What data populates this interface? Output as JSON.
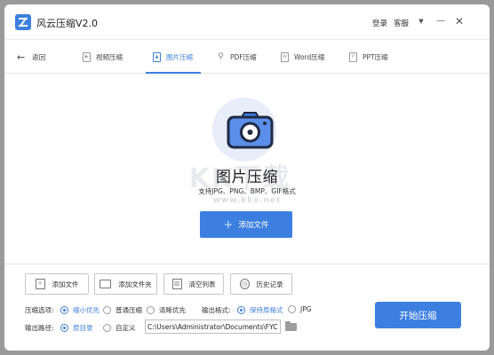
{
  "app": {
    "title": "风云压缩V2.0"
  },
  "titlebar": {
    "login": "登录",
    "service": "客服",
    "menu_icon": "dropdown-triangle",
    "minimize_icon": "minus",
    "close_icon": "x"
  },
  "nav": {
    "back_label": "返回",
    "tabs": [
      {
        "label": "视频压缩",
        "icon": "video-file-icon",
        "active": false
      },
      {
        "label": "图片压缩",
        "icon": "image-file-icon",
        "active": true
      },
      {
        "label": "PDF压缩",
        "icon": "pdf-file-icon",
        "active": false
      },
      {
        "label": "Word压缩",
        "icon": "word-file-icon",
        "active": false
      },
      {
        "label": "PPT压缩",
        "icon": "ppt-file-icon",
        "active": false
      }
    ]
  },
  "main": {
    "title": "图片压缩",
    "subtitle": "支持JPG、PNG、BMP、GIF格式",
    "add_file_label": "添加文件",
    "watermark_text": "KK下载",
    "watermark_url": "www.kkx.net"
  },
  "toolbar": {
    "add_file": "添加文件",
    "add_folder": "添加文件夹",
    "clear_list": "清空列表",
    "history": "历史记录"
  },
  "options": {
    "compress_label": "压缩选项:",
    "compress_options": [
      {
        "label": "缩小优先",
        "selected": true
      },
      {
        "label": "普通压缩",
        "selected": false
      },
      {
        "label": "清晰优先",
        "selected": false
      }
    ],
    "format_label": "输出格式:",
    "format_options": [
      {
        "label": "保持原格式",
        "selected": true
      },
      {
        "label": "JPG",
        "selected": false
      }
    ],
    "output_label": "输出路径:",
    "output_options": [
      {
        "label": "原目录",
        "selected": true
      },
      {
        "label": "自定义",
        "selected": false
      }
    ],
    "output_path": "C:\\Users\\Administrator\\Documents\\FYCompress"
  },
  "start_label": "开始压缩",
  "colors": {
    "accent": "#3d7fe0",
    "icon_bg": "#e8eef9"
  }
}
